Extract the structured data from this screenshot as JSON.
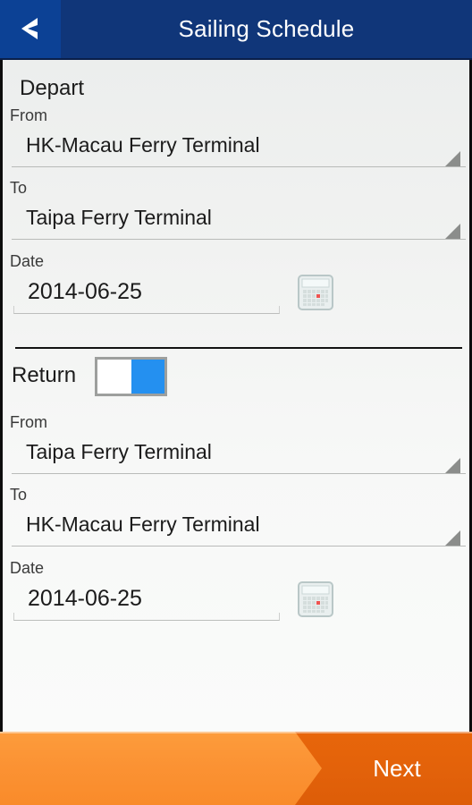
{
  "header": {
    "title": "Sailing Schedule",
    "back_icon": "back-chevron-icon",
    "bg_color": "#103679",
    "back_bg_color": "#0c4195"
  },
  "depart": {
    "heading": "Depart",
    "from_label": "From",
    "from_value": "HK-Macau Ferry Terminal",
    "to_label": "To",
    "to_value": "Taipa Ferry Terminal",
    "date_label": "Date",
    "date_value": "2014-06-25",
    "calendar_icon": "calendar-icon"
  },
  "return": {
    "label": "Return",
    "toggle_state": "on",
    "toggle_on_color": "#2490f0",
    "toggle_border_color": "#9d9f9d",
    "from_label": "From",
    "from_value": "Taipa Ferry Terminal",
    "to_label": "To",
    "to_value": "HK-Macau Ferry Terminal",
    "date_label": "Date",
    "date_value": "2014-06-25",
    "calendar_icon": "calendar-icon"
  },
  "footer": {
    "next_label": "Next",
    "accent_color": "#fb9233",
    "accent_dark_color": "#e3620a"
  }
}
